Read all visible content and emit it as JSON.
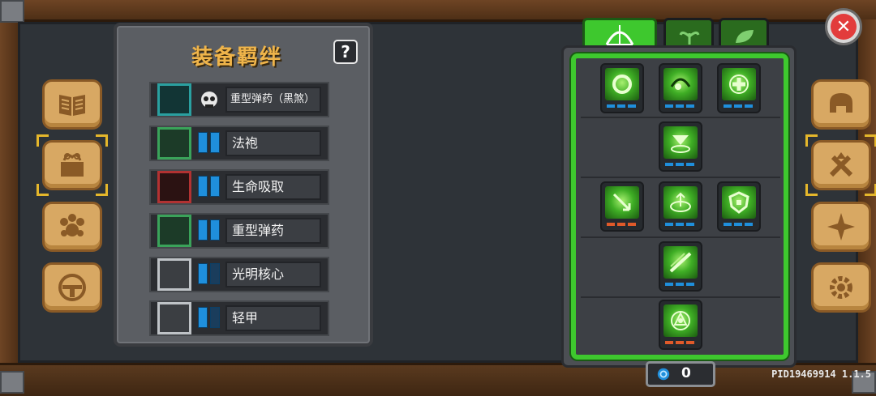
{
  "bonds": {
    "title": "装备羁绊",
    "help_label": "?",
    "items": [
      {
        "icon": "heavy-ammo-black-icon",
        "level_icon": "skull",
        "label": "重型弹药（黑煞）"
      },
      {
        "icon": "magic-robe-icon",
        "level": 2,
        "label": "法袍"
      },
      {
        "icon": "life-drain-icon",
        "level": 2,
        "label": "生命吸取"
      },
      {
        "icon": "heavy-ammo-icon",
        "level": 2,
        "label": "重型弹药"
      },
      {
        "icon": "light-core-icon",
        "level": 1,
        "label": "光明核心"
      },
      {
        "icon": "light-armor-icon",
        "level": 1,
        "label": "轻甲"
      }
    ]
  },
  "left_tabs": [
    "book-icon",
    "tome-icon",
    "pawprint-icon",
    "shield-icon"
  ],
  "right_tabs": [
    "helmet-icon",
    "weapon-upgrade-icon",
    "compass-icon",
    "gear-icon"
  ],
  "talent_tabs": [
    "bow-icon",
    "sprout-icon",
    "leaf-icon"
  ],
  "talent_skills": [
    {
      "row": 0,
      "icons": [
        "ring-skill-icon",
        "orb-skill-icon",
        "heal-skill-icon"
      ]
    },
    {
      "row": 1,
      "icons": [
        "downward-burst-icon"
      ]
    },
    {
      "row": 2,
      "icons": [
        "arrow-skill-icon",
        "target-skill-icon",
        "shield-skill-icon"
      ]
    },
    {
      "row": 3,
      "icons": [
        "dash-skill-icon"
      ]
    },
    {
      "row": 4,
      "icons": [
        "rune-skill-icon"
      ]
    }
  ],
  "currency": {
    "icon": "gem-icon",
    "value": "0"
  },
  "version": "PID19469914 1.1.5",
  "close_label": "✕",
  "colors": {
    "accent_green": "#3ec82e",
    "title_gold": "#efb44a",
    "wood": "#5a3a1f"
  }
}
